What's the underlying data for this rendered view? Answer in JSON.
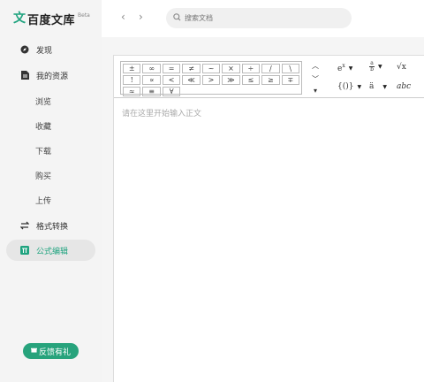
{
  "brand": {
    "name": "百度文库",
    "beta": "Beta",
    "mark": "文"
  },
  "sidebar": {
    "discover": "发现",
    "my_resources": "我的资源",
    "sub": [
      "浏览",
      "收藏",
      "下载",
      "购买",
      "上传"
    ],
    "format_convert": "格式转换",
    "formula_edit": "公式编辑",
    "feedback": "反馈有礼"
  },
  "topbar": {
    "back": "‹",
    "forward": "›",
    "search_placeholder": "搜索文档"
  },
  "symbols": [
    "±",
    "∞",
    "=",
    "≠",
    "~",
    "×",
    "÷",
    "/",
    "\\",
    "!",
    "∝",
    "<",
    "≪",
    ">",
    "≫",
    "≤",
    "≥",
    "∓",
    "≈",
    "≡",
    "∀"
  ],
  "templates": {
    "sup": "e",
    "sup_exp": "x",
    "frac": "a/b",
    "root": "√x",
    "brace": "{()}",
    "acc": "ä",
    "arc": "abc"
  },
  "editor": {
    "placeholder": "请在这里开始输入正文"
  },
  "colors": {
    "accent": "#1fa37f",
    "feedback_bg": "#27a37c",
    "sidebar_bg": "#f4f4f4"
  }
}
